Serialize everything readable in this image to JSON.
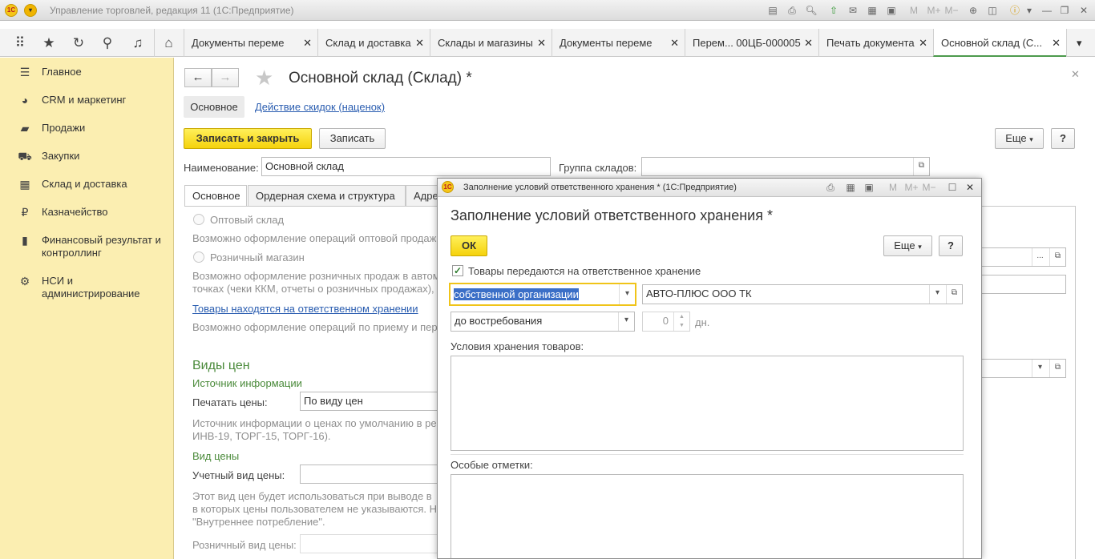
{
  "titlebar": {
    "title": "Управление торговлей, редакция 11  (1С:Предприятие)"
  },
  "tabs": [
    {
      "label": "Документы переме"
    },
    {
      "label": "Склад и доставка"
    },
    {
      "label": "Склады и магазины"
    },
    {
      "label": "Документы переме"
    },
    {
      "label": "Перем... 00ЦБ-000005"
    },
    {
      "label": "Печать документа"
    },
    {
      "label": "Основной склад (С..."
    }
  ],
  "sidebar": {
    "items": [
      {
        "label": "Главное",
        "icon": "menu-icon"
      },
      {
        "label": "CRM и маркетинг",
        "icon": "pie-chart-icon"
      },
      {
        "label": "Продажи",
        "icon": "shopping-bag-icon"
      },
      {
        "label": "Закупки",
        "icon": "cart-icon"
      },
      {
        "label": "Склад и доставка",
        "icon": "warehouse-icon"
      },
      {
        "label": "Казначейство",
        "icon": "ruble-icon"
      },
      {
        "label": "Финансовый результат и контроллинг",
        "icon": "bar-chart-icon"
      },
      {
        "label": "НСИ и администрирование",
        "icon": "gear-icon"
      }
    ]
  },
  "form": {
    "title": "Основной склад (Склад) *",
    "subtabs": [
      "Основное",
      "Действие скидок (наценок)"
    ],
    "save_close": "Записать и закрыть",
    "save": "Записать",
    "more": "Еще",
    "help": "?",
    "name_label": "Наименование:",
    "name_value": "Основной склад",
    "group_label": "Группа складов:",
    "group_value": "",
    "tabs": [
      "Основное",
      "Ордерная схема и структура",
      "Адре"
    ],
    "wholesale_label": "Оптовый склад",
    "wholesale_desc": "Возможно оформление операций оптовой продажи",
    "retail_label": "Розничный магазин",
    "retail_desc_1": "Возможно оформление розничных продаж в автом",
    "retail_desc_2": "точках (чеки ККМ, отчеты о розничных продажах),",
    "custody_link": "Товары находятся на ответственном хранении",
    "custody_desc": "Возможно оформление операций по приему и пере",
    "prices_header": "Виды цен",
    "info_source": "Источник информации",
    "print_prices_label": "Печатать цены:",
    "print_prices_value": "По виду цен",
    "info_desc_1": "Источник информации о ценах по умолчанию в ре",
    "info_desc_2": "ИНВ-19, ТОРГ-15, ТОРГ-16).",
    "price_type": "Вид цены",
    "account_price_label": "Учетный вид цены:",
    "account_price_value": "",
    "price_desc_1": "Этот вид цен будет использоваться при выводе в",
    "price_desc_2": "в которых цены пользователем не указываются. Н",
    "price_desc_3": "\"Внутреннее потребление\".",
    "retail_price_label": "Розничный вид цены:"
  },
  "dialog": {
    "window_title": "Заполнение условий ответственного хранения *  (1С:Предприятие)",
    "title": "Заполнение условий ответственного хранения *",
    "ok": "ОК",
    "more": "Еще",
    "help": "?",
    "checkbox_label": "Товары передаются на ответственное хранение",
    "checkbox_checked": true,
    "owner_type": "собственной организации",
    "counterparty": "АВТО-ПЛЮС ООО ТК",
    "term": "до востребования",
    "days_value": "0",
    "days_unit": "дн.",
    "conditions_label": "Условия хранения товаров:",
    "notes_label": "Особые отметки:"
  }
}
